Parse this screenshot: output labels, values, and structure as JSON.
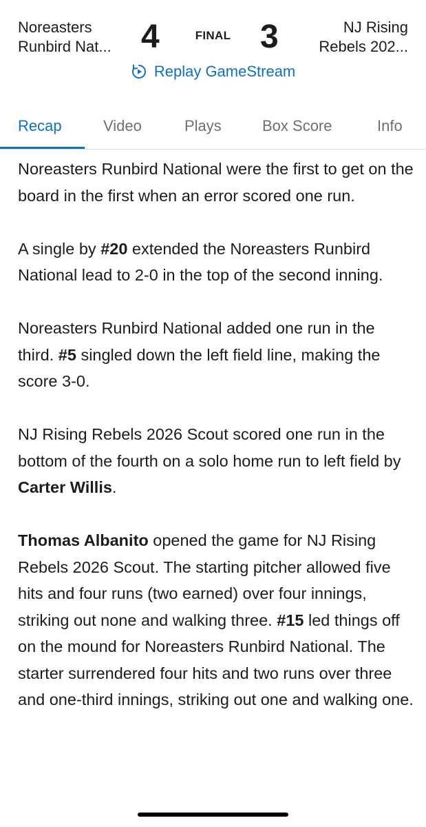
{
  "game": {
    "away_team_line1": "Noreasters",
    "away_team_line2": "Runbird Nat...",
    "away_score": "4",
    "status": "FINAL",
    "home_score": "3",
    "home_team_line1": "NJ Rising",
    "home_team_line2": "Rebels 202...",
    "replay_label": "Replay GameStream"
  },
  "tabs": [
    {
      "label": "Recap",
      "active": true
    },
    {
      "label": "Video",
      "active": false
    },
    {
      "label": "Plays",
      "active": false
    },
    {
      "label": "Box Score",
      "active": false
    },
    {
      "label": "Info",
      "active": false
    }
  ],
  "recap": {
    "p1": "Noreasters Runbird National were the first to get on the board in the first when an error scored one run.",
    "p2_a": "A single by ",
    "p2_b": "#20",
    "p2_c": " extended the Noreasters Runbird National lead to 2-0 in the top of the second inning.",
    "p3_a": "Noreasters Runbird National added one run in the third. ",
    "p3_b": "#5",
    "p3_c": " singled down the left field line, making the score 3-0.",
    "p4_a": "NJ Rising Rebels 2026 Scout scored one run in the bottom of the fourth on a solo home run to left field by ",
    "p4_b": "Carter Willis",
    "p4_c": ".",
    "p5_a": "Thomas Albanito",
    "p5_b": " opened the game for NJ Rising Rebels 2026 Scout. The starting pitcher allowed five hits and four runs (two earned) over four innings, striking out none and walking three. ",
    "p5_c": "#15",
    "p5_d": " led things off on the mound for Noreasters Runbird National. The starter surrendered four hits and two runs over three and one-third innings, striking out one and walking one."
  },
  "colors": {
    "accent": "#0a72c9",
    "text": "#1c1c1e",
    "inactive_tab": "#6e6e73"
  }
}
